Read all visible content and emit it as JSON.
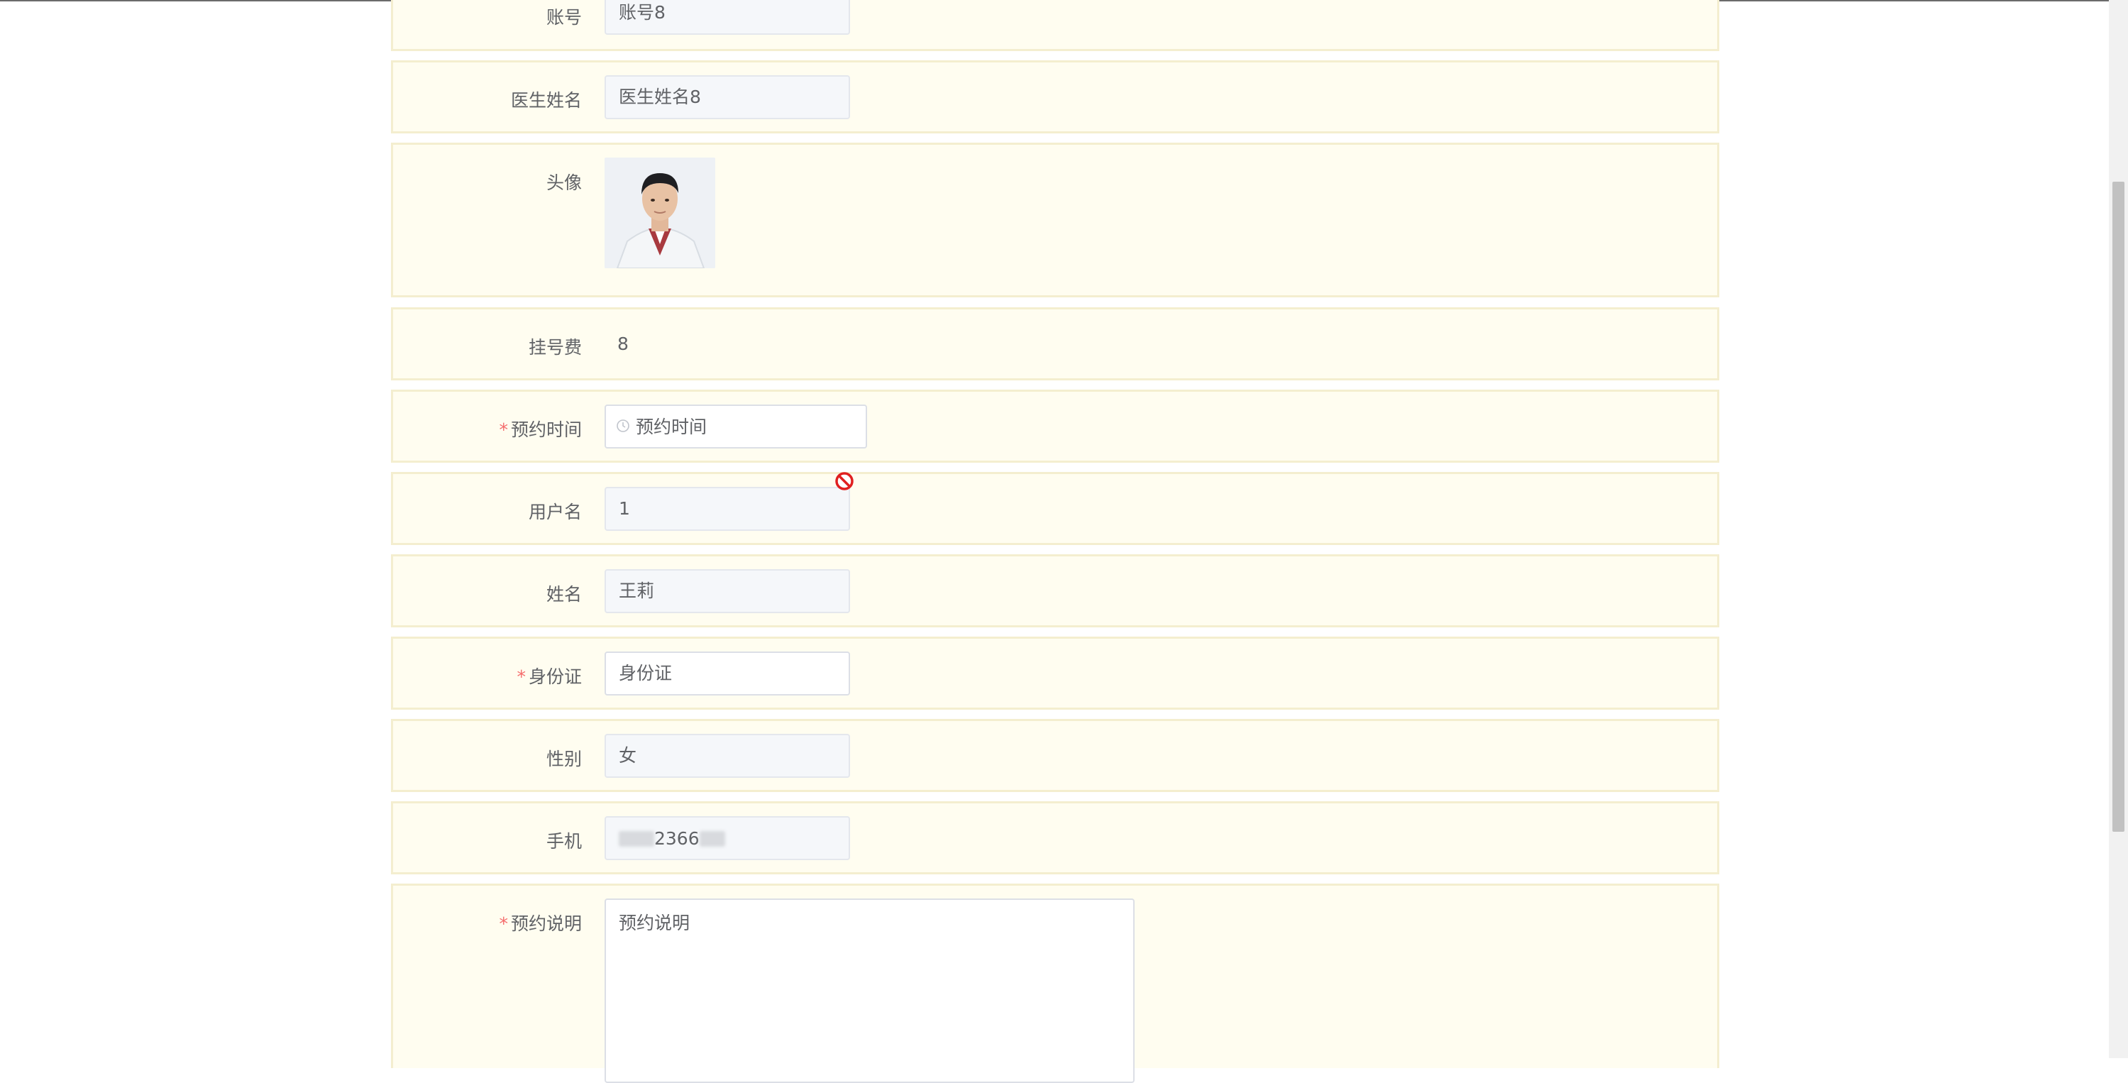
{
  "form": {
    "account": {
      "label": "账号",
      "value": "账号8"
    },
    "doctor_name": {
      "label": "医生姓名",
      "value": "医生姓名8"
    },
    "avatar": {
      "label": "头像"
    },
    "fee": {
      "label": "挂号费",
      "value": "8"
    },
    "appointment_time": {
      "label": "预约时间",
      "placeholder": "预约时间",
      "required_mark": "*"
    },
    "username": {
      "label": "用户名",
      "value": "1"
    },
    "name": {
      "label": "姓名",
      "value": "王莉"
    },
    "id_card": {
      "label": "身份证",
      "placeholder": "身份证",
      "required_mark": "*"
    },
    "gender": {
      "label": "性别",
      "value": "女"
    },
    "phone": {
      "label": "手机",
      "value_visible": "2366"
    },
    "appointment_note": {
      "label": "预约说明",
      "placeholder": "预约说明",
      "required_mark": "*"
    }
  },
  "colors": {
    "row_bg": "#fffdf0",
    "row_border": "#f4eecf",
    "required": "#f56c6c",
    "disabled_bg": "#f5f7fa",
    "not_allowed_icon": "#e02020"
  },
  "icons": {
    "time": "clock-icon",
    "cursor": "not-allowed-icon"
  }
}
